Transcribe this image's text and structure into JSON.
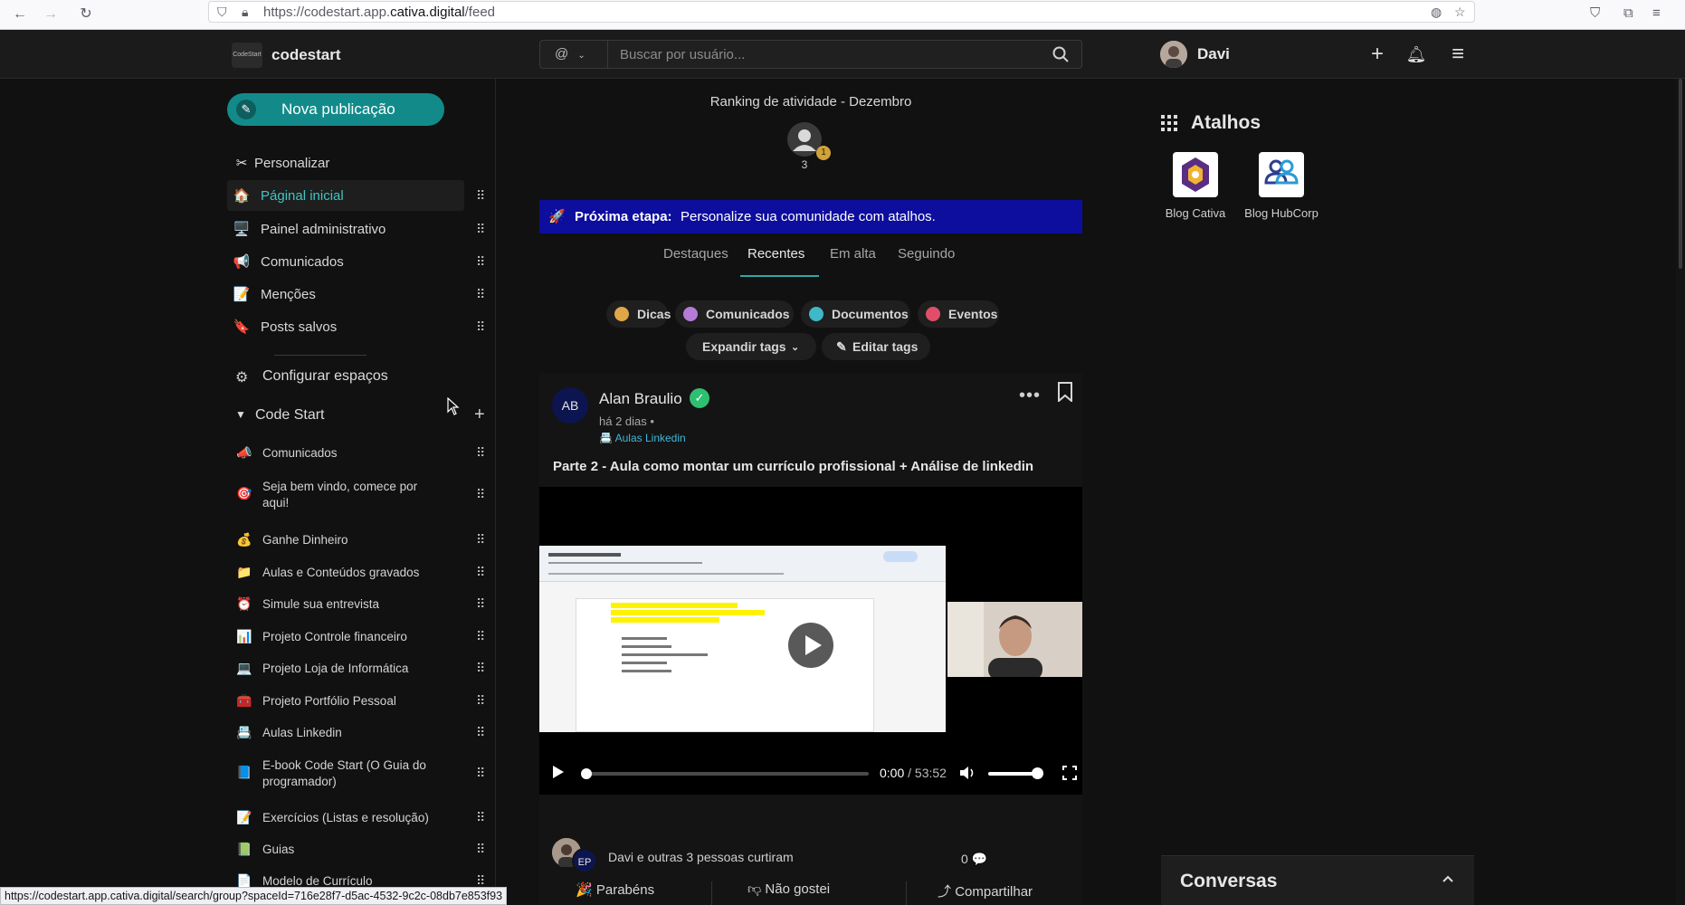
{
  "browser": {
    "url_prefix": "https://codestart.app.",
    "url_domain": "cativa.digital",
    "url_suffix": "/feed",
    "status_url": "https://codestart.app.cativa.digital/search/group?spaceId=716e28f7-d5ac-4532-9c2c-08db7e853f93"
  },
  "header": {
    "brand": "codestart",
    "logo_text": "CodeStart",
    "search_prefix": "@",
    "search_placeholder": "Buscar por usuário...",
    "user_name": "Davi"
  },
  "sidebar": {
    "new_post": "Nova publicação",
    "customize": "Personalizar",
    "nav": [
      {
        "label": "Páginal inicial",
        "icon": "home-icon"
      },
      {
        "label": "Painel administrativo",
        "icon": "admin-panel-icon"
      },
      {
        "label": "Comunicados",
        "icon": "megaphone-icon"
      },
      {
        "label": "Menções",
        "icon": "mentions-icon"
      },
      {
        "label": "Posts salvos",
        "icon": "saved-posts-icon"
      }
    ],
    "configure_spaces": "Configurar espaços",
    "group_name": "Code Start",
    "spaces": [
      {
        "label": "Comunicados",
        "icon": "📣"
      },
      {
        "label": "Seja bem vindo, comece por aqui!",
        "icon": "🎯"
      },
      {
        "label": "Ganhe Dinheiro",
        "icon": "💰"
      },
      {
        "label": "Aulas e Conteúdos gravados",
        "icon": "📁"
      },
      {
        "label": "Simule sua entrevista",
        "icon": "⏰"
      },
      {
        "label": "Projeto Controle financeiro",
        "icon": "📊"
      },
      {
        "label": "Projeto Loja de Informática",
        "icon": "💻"
      },
      {
        "label": "Projeto Portfólio Pessoal",
        "icon": "🧰"
      },
      {
        "label": "Aulas Linkedin",
        "icon": "📇"
      },
      {
        "label": "E-book Code Start (O Guia do programador)",
        "icon": "📘"
      },
      {
        "label": "Exercícios (Listas e resolução)",
        "icon": "📝"
      },
      {
        "label": "Guias",
        "icon": "📗"
      },
      {
        "label": "Modelo de Currículo",
        "icon": "📄"
      }
    ]
  },
  "feed": {
    "ranking_title": "Ranking de atividade - Dezembro",
    "ranking_badge": "1",
    "ranking_count": "3",
    "next_step_label": "Próxima etapa:",
    "next_step_text": "Personalize sua comunidade com atalhos.",
    "tabs": [
      "Destaques",
      "Recentes",
      "Em alta",
      "Seguindo"
    ],
    "active_tab": "Recentes",
    "tags": [
      "Dicas",
      "Comunicados",
      "Documentos",
      "Eventos"
    ],
    "expand_tags": "Expandir tags",
    "edit_tags": "Editar tags",
    "post": {
      "author_initials": "AB",
      "author": "Alan Braulio",
      "time": "há 2 dias •",
      "space": "Aulas Linkedin",
      "title": "Parte 2 - Aula como montar um currículo profissional + Análise de linkedin",
      "video_current": "0:00",
      "video_duration": "/ 53:52",
      "video_progress": 0,
      "volume": 1,
      "likes_initials": "EP",
      "likes_text": "Davi e outras 3 pessoas curtiram",
      "comment_count": "0",
      "actions": [
        "Parabéns",
        "Não gostei",
        "Compartilhar"
      ]
    }
  },
  "right": {
    "shortcuts_title": "Atalhos",
    "shortcuts": [
      {
        "label": "Blog Cativa"
      },
      {
        "label": "Blog HubCorp"
      }
    ],
    "chat_title": "Conversas"
  },
  "colors": {
    "accent": "#138a8a",
    "next_step_bg": "#0d0d9e",
    "verified": "#2fbf71"
  }
}
